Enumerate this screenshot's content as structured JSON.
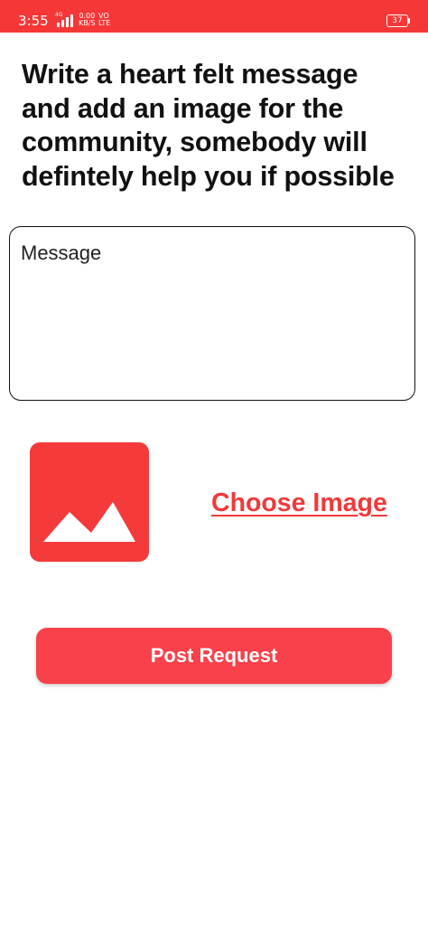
{
  "status_bar": {
    "time": "3:55",
    "network_type": "4G",
    "speed_value": "0.00",
    "speed_unit": "KB/S",
    "volte_line1": "VO",
    "volte_line2": "LTE",
    "battery_level": "37",
    "background_color": "#f53737",
    "icons": [
      "signal-bars-icon",
      "battery-icon"
    ]
  },
  "headline": "Write a heart felt message and add an image for the community, somebody will defintely help you if possible",
  "message_input": {
    "placeholder": "Message",
    "value": ""
  },
  "image_picker": {
    "icon": "image-placeholder-icon",
    "icon_color": "#f53a3c",
    "choose_label": "Choose Image",
    "link_color": "#f03a3a"
  },
  "post_button": {
    "label": "Post Request",
    "color": "#f8414a"
  }
}
